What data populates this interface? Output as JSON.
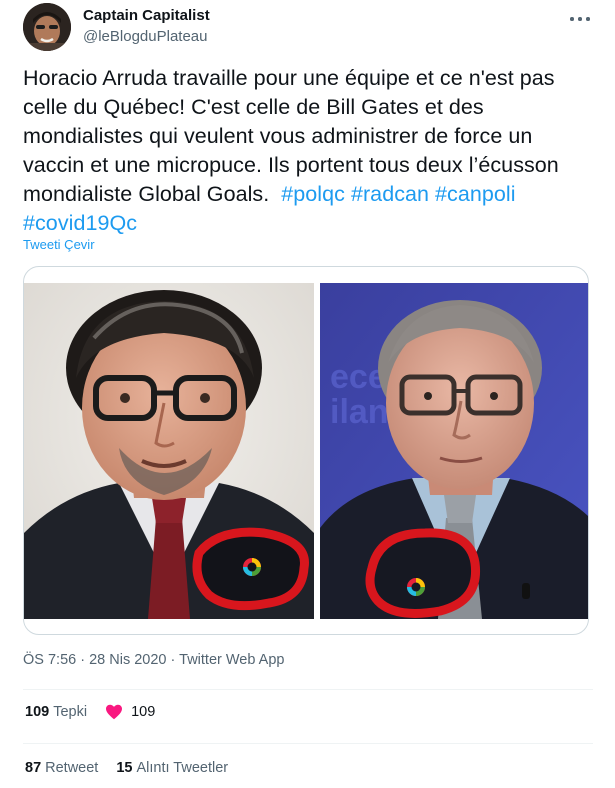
{
  "author": {
    "name": "Captain Capitalist",
    "handle": "@leBlogduPlateau"
  },
  "tweet": {
    "text_main": "Horacio Arruda travaille pour une équipe et ce n'est pas celle du Québec! C'est celle de Bill Gates et des mondialistes qui veulent vous administrer de force un vaccin et une micropuce. Ils portent tous deux l’écusson mondialiste Global Goals.",
    "hashtags": [
      "#polqc",
      "#radcan",
      "#canpoli",
      "#covid19Qc"
    ],
    "translate_label": "Tweeti Çevir"
  },
  "meta": {
    "time": "ÖS 7:56",
    "sep1": "·",
    "date": "28 Nis 2020",
    "sep2": "·",
    "source": "Twitter Web App"
  },
  "stats": {
    "reactions_count": "109",
    "reactions_label": "Tepki",
    "likes_count": "109",
    "retweets_count": "87",
    "retweets_label": "Retweet",
    "quotes_count": "15",
    "quotes_label": "Alıntı Tweetler"
  },
  "icons": {
    "more": "more-horizontal-icon",
    "heart": "heart-icon"
  },
  "colors": {
    "link": "#1d9bf0",
    "like": "#f91880",
    "secondary_text": "#536471",
    "annotation_red": "#d8161d"
  }
}
